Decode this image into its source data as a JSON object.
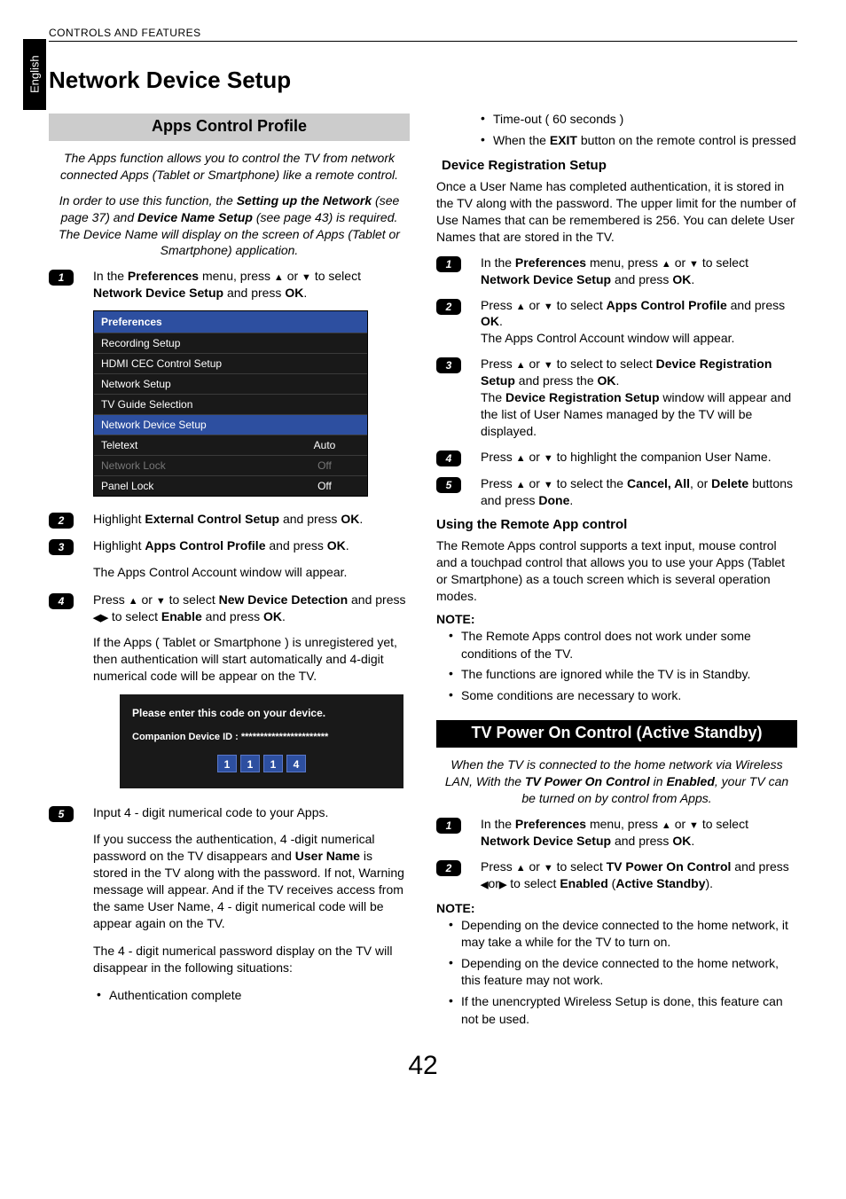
{
  "header": "CONTROLS AND FEATURES",
  "lang_tab": "English",
  "page_number": "42",
  "left": {
    "main_title": "Network Device Setup",
    "section_title": "Apps Control Profile",
    "intro1": "The Apps function allows you to control the TV from network connected Apps (Tablet or Smartphone) like a remote control.",
    "intro2_a": "In order to use this function, the ",
    "intro2_b": "Setting up the Network",
    "intro2_c": " (see page 37) and ",
    "intro2_d": "Device Name Setup",
    "intro2_e": " (see page 43) is required. The Device Name will display on the screen of Apps (Tablet or Smartphone) application.",
    "step1_a": "In the ",
    "step1_b": "Preferences",
    "step1_c": " menu, press ",
    "step1_d": " or ",
    "step1_e": " to select ",
    "step1_f": "Network Device Setup",
    "step1_g": " and press ",
    "step1_h": "OK",
    "step1_i": ".",
    "step2_a": "Highlight ",
    "step2_b": "External Control Setup",
    "step2_c": " and press ",
    "step2_d": "OK",
    "step2_e": ".",
    "step3_a": "Highlight ",
    "step3_b": "Apps Control Profile",
    "step3_c": " and press ",
    "step3_d": "OK",
    "step3_e": ".",
    "step3_tail": "The Apps Control Account window will appear.",
    "step4_a": "Press ",
    "step4_b": " or ",
    "step4_c": " to select ",
    "step4_d": "New Device Detection",
    "step4_e": " and press ",
    "step4_f": " to select ",
    "step4_g": "Enable",
    "step4_h": "  and press ",
    "step4_i": "OK",
    "step4_j": ".",
    "step4_tail": "If the Apps ( Tablet or Smartphone ) is unregistered yet, then authentication will start automatically and 4-digit numerical code will be appear on the TV.",
    "step5": "Input 4 - digit numerical code to your Apps.",
    "step5_tail1_a": "If you success the authentication, 4 -digit numerical password on the TV disappears and ",
    "step5_tail1_b": "User Name",
    "step5_tail1_c": " is stored in the TV along with the password. If not, Warning message will appear. And if the TV receives access from the same User Name, 4 - digit numerical code will be appear again on the TV.",
    "step5_tail2": "The 4 - digit numerical password display on the TV will disappear in the following situations:",
    "bullet1": "Authentication complete"
  },
  "menu": {
    "title": "Preferences",
    "rows": [
      {
        "label": "Recording Setup",
        "value": ""
      },
      {
        "label": "HDMI CEC Control Setup",
        "value": ""
      },
      {
        "label": "Network Setup",
        "value": ""
      },
      {
        "label": "TV Guide Selection",
        "value": ""
      },
      {
        "label": "Network Device Setup",
        "value": "",
        "hl": true
      },
      {
        "label": "Teletext",
        "value": "Auto"
      },
      {
        "label": "Network Lock",
        "value": "Off",
        "dim": true
      },
      {
        "label": "Panel Lock",
        "value": "Off"
      }
    ]
  },
  "codebox": {
    "line1": "Please enter this code on your device.",
    "line2": "Companion Device ID :  ***********************",
    "digits": [
      "1",
      "1",
      "1",
      "4"
    ]
  },
  "right": {
    "bullet_top1": "Time-out ( 60 seconds )",
    "bullet_top2_a": "When the ",
    "bullet_top2_b": "EXIT",
    "bullet_top2_c": " button on the remote control is pressed",
    "drs_title": "Device Registration Setup",
    "drs_intro": "Once a User Name has completed authentication, it is stored in the TV along with the password. The upper limit for the number of Use Names that can be remembered is 256. You can delete User Names that are stored in the TV.",
    "r_step2_a": "Press ",
    "r_step2_b": " or ",
    "r_step2_c": " to select ",
    "r_step2_d": "Apps Control Profile",
    "r_step2_e": " and press ",
    "r_step2_f": "OK",
    "r_step2_g": ".",
    "r_step2_tail": "The Apps Control Account window will appear.",
    "r_step3_a": "Press ",
    "r_step3_b": " or ",
    "r_step3_c": " to select to select ",
    "r_step3_d": "Device Registration Setup",
    "r_step3_e": " and press the ",
    "r_step3_f": "OK",
    "r_step3_g": ".",
    "r_step3_tail_a": "The ",
    "r_step3_tail_b": "Device Registration Setup",
    "r_step3_tail_c": " window will appear and the list of User Names managed by the TV will be displayed.",
    "r_step4_a": "Press ",
    "r_step4_b": " or ",
    "r_step4_c": " to highlight the companion User Name.",
    "r_step5_a": "Press ",
    "r_step5_b": " or ",
    "r_step5_c": " to select the ",
    "r_step5_d": "Cancel, All",
    "r_step5_e": ", or ",
    "r_step5_f": "Delete",
    "r_step5_g": " buttons and press ",
    "r_step5_h": "Done",
    "r_step5_i": ".",
    "remote_title": "Using the Remote App control",
    "remote_intro": "The Remote Apps control supports a text input, mouse control and a touchpad control that allows you to use your Apps (Tablet or Smartphone) as a touch screen which is several operation modes.",
    "note": "NOTE:",
    "remote_note1": "The Remote Apps control does not work under some conditions of the TV.",
    "remote_note2": "The functions are ignored while the TV is in Standby.",
    "remote_note3": "Some conditions are necessary to work.",
    "tvpower_title": "TV Power On Control (Active Standby)",
    "tvpower_intro_a": "When the TV is connected to the home network via Wireless LAN, With the ",
    "tvpower_intro_b": "TV Power On Control",
    "tvpower_intro_c": " in ",
    "tvpower_intro_d": "Enabled",
    "tvpower_intro_e": ", your TV can be turned on by control from Apps.",
    "tv_step2_a": "Press ",
    "tv_step2_b": " or ",
    "tv_step2_c": " to select ",
    "tv_step2_d": "TV Power On Control",
    "tv_step2_e": " and press ",
    "tv_step2_f": "or",
    "tv_step2_g": " to select ",
    "tv_step2_h": "Enabled",
    "tv_step2_i": " (",
    "tv_step2_j": "Active Standby",
    "tv_step2_k": ").",
    "tv_note1": "Depending on the device connected to the home network, it may take a while for the TV to turn on.",
    "tv_note2": "Depending on the device connected to the home network, this feature may not work.",
    "tv_note3": "If the unencrypted Wireless Setup is done, this feature can not be used."
  }
}
